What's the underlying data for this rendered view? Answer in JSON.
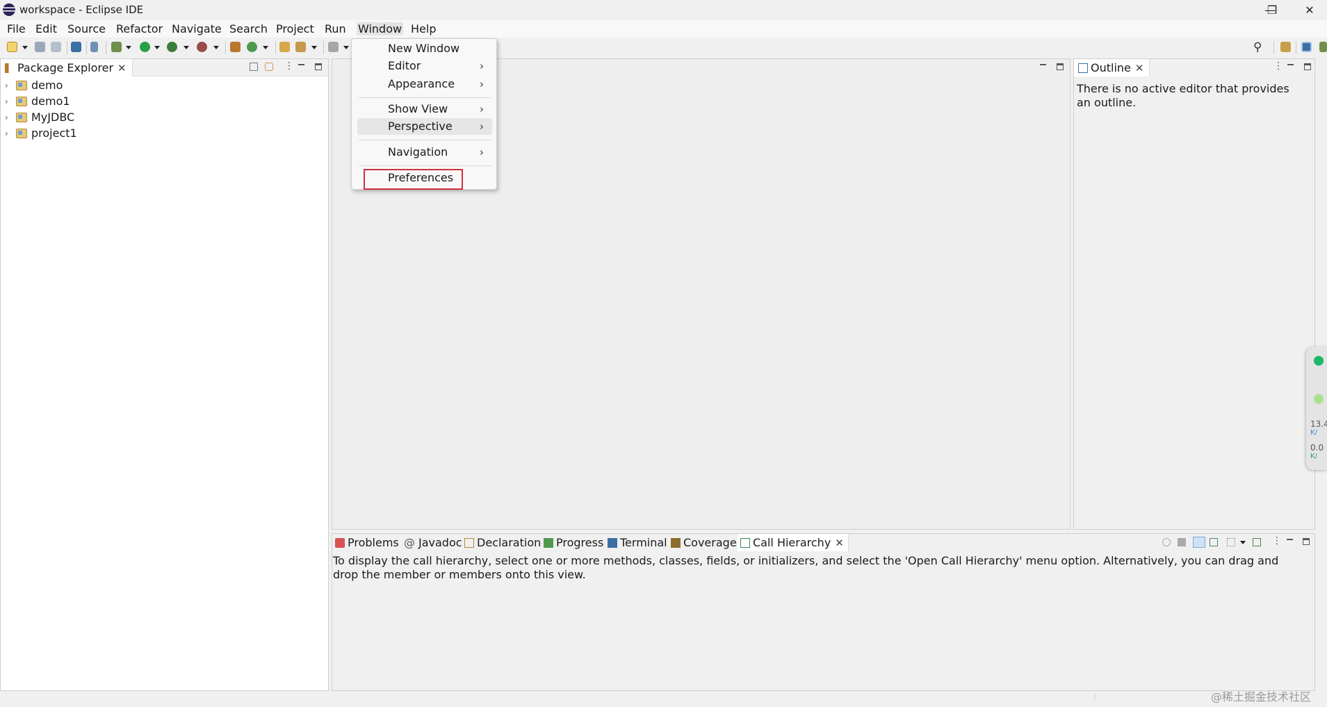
{
  "window": {
    "title": "workspace - Eclipse IDE",
    "minimize": "—",
    "restore": "❐",
    "close": "✕"
  },
  "menubar": {
    "items": [
      "File",
      "Edit",
      "Source",
      "Refactor",
      "Navigate",
      "Search",
      "Project",
      "Run",
      "Window",
      "Help"
    ]
  },
  "package_explorer": {
    "tab_label": "Package Explorer",
    "projects": [
      "demo",
      "demo1",
      "MyJDBC",
      "project1"
    ]
  },
  "outline": {
    "tab_label": "Outline",
    "message": "There is no active editor that provides an outline."
  },
  "bottom_panel": {
    "tabs": [
      "Problems",
      "Javadoc",
      "Declaration",
      "Progress",
      "Terminal",
      "Coverage",
      "Call Hierarchy"
    ],
    "active_tab": "Call Hierarchy",
    "message": "To display the call hierarchy, select one or more methods, classes, fields, or initializers, and select the 'Open Call Hierarchy' menu option. Alternatively, you can drag and drop the member or members onto this view."
  },
  "window_menu": {
    "items": [
      {
        "label": "New Window",
        "submenu": false
      },
      {
        "label": "Editor",
        "submenu": true
      },
      {
        "label": "Appearance",
        "submenu": true
      },
      {
        "label": "Show View",
        "submenu": true
      },
      {
        "label": "Perspective",
        "submenu": true
      },
      {
        "label": "Navigation",
        "submenu": true
      },
      {
        "label": "Preferences",
        "submenu": false
      }
    ],
    "chevron": "›"
  },
  "net_widget": {
    "upload_value": "13.4",
    "upload_unit": "K/",
    "download_value": "0.0",
    "download_unit": "K/"
  },
  "watermark": "@稀土掘金技术社区",
  "colors": {
    "highlight_border": "#d0303a",
    "widget_green": "#1fb86a"
  }
}
